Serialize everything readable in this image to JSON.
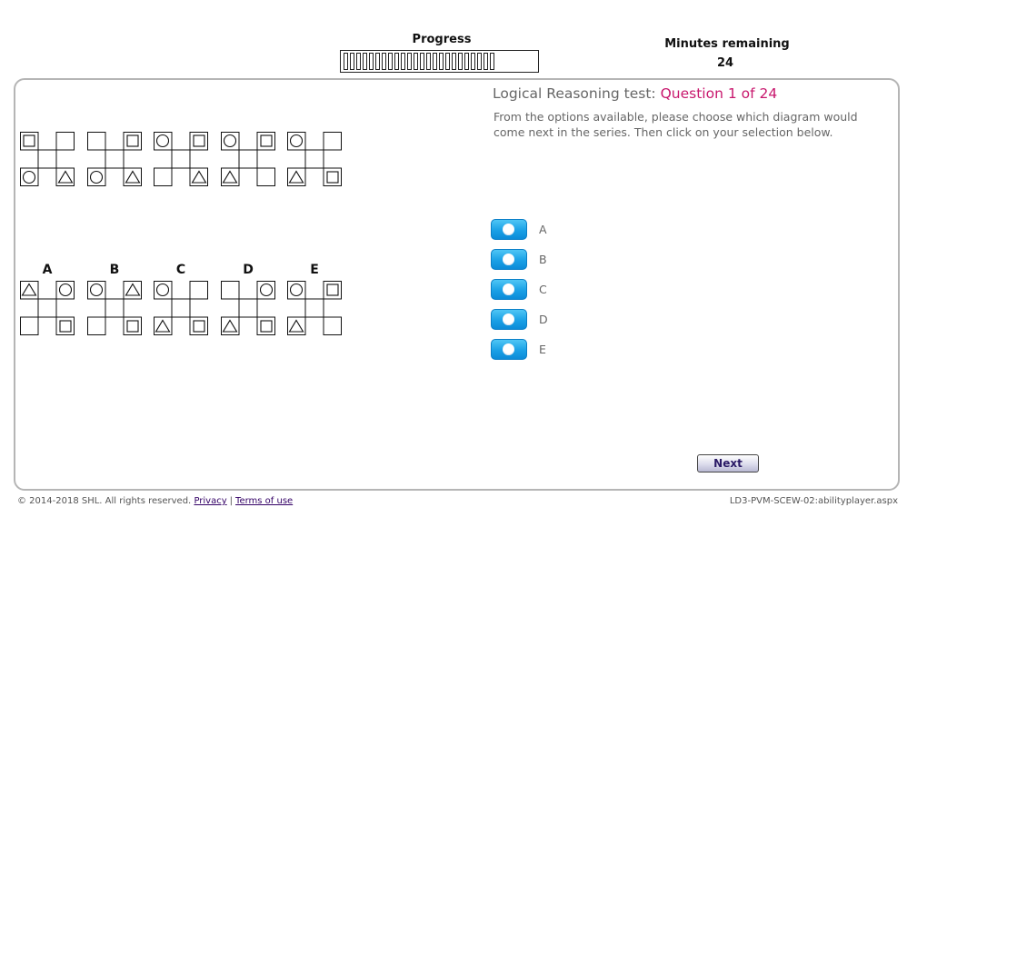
{
  "header": {
    "progress_label": "Progress",
    "progress_total_segments": 24,
    "progress_completed_segments": 0,
    "timer_label": "Minutes remaining",
    "timer_value": "24"
  },
  "question": {
    "test_name": "Logical Reasoning test:",
    "number_text": "Question 1 of 24",
    "instructions": "From the options available, please choose which diagram would come next in the series. Then click on your selection below."
  },
  "series_figures": [
    {
      "tl": "square",
      "tr": "",
      "bl": "circle",
      "br": "triangle"
    },
    {
      "tl": "",
      "tr": "square",
      "bl": "circle",
      "br": "triangle"
    },
    {
      "tl": "circle",
      "tr": "square",
      "bl": "",
      "br": "triangle"
    },
    {
      "tl": "circle",
      "tr": "square",
      "bl": "triangle",
      "br": ""
    },
    {
      "tl": "circle",
      "tr": "",
      "bl": "triangle",
      "br": "square"
    }
  ],
  "answer_figures": [
    {
      "letter": "A",
      "tl": "triangle",
      "tr": "circle",
      "bl": "",
      "br": "square"
    },
    {
      "letter": "B",
      "tl": "circle",
      "tr": "triangle",
      "bl": "",
      "br": "square"
    },
    {
      "letter": "C",
      "tl": "circle",
      "tr": "",
      "bl": "triangle",
      "br": "square"
    },
    {
      "letter": "D",
      "tl": "",
      "tr": "circle",
      "bl": "triangle",
      "br": "square"
    },
    {
      "letter": "E",
      "tl": "circle",
      "tr": "square",
      "bl": "triangle",
      "br": ""
    }
  ],
  "options": [
    "A",
    "B",
    "C",
    "D",
    "E"
  ],
  "next_label": "Next",
  "footer": {
    "copyright": "© 2014-2018 SHL. All rights reserved.",
    "privacy": "Privacy",
    "separator": "|",
    "terms": "Terms of use",
    "page_id": "LD3-PVM-SCEW-02:abilityplayer.aspx"
  },
  "colors": {
    "question_number": "#c8176d",
    "radio_blue": "#1aa0e6",
    "link": "#330066"
  }
}
